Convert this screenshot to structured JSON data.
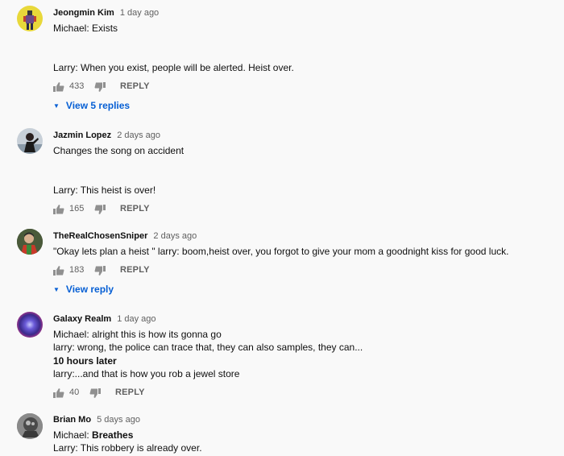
{
  "comments": [
    {
      "author": "Jeongmin Kim",
      "time": "1 day ago",
      "lines": [
        "Michael: Exists",
        "",
        "",
        "Larry: When you exist, people will be alerted. Heist over."
      ],
      "likes": "433",
      "reply_label": "REPLY",
      "view_replies": "View 5 replies"
    },
    {
      "author": "Jazmin Lopez",
      "time": "2 days ago",
      "lines": [
        "Changes the song on accident",
        "",
        "",
        "Larry: This heist is over!"
      ],
      "likes": "165",
      "reply_label": "REPLY"
    },
    {
      "author": "TheRealChosenSniper",
      "time": "2 days ago",
      "lines": [
        "\"Okay lets plan a heist \" larry: boom,heist over, you forgot to give your mom a goodnight kiss for good luck."
      ],
      "likes": "183",
      "reply_label": "REPLY",
      "view_replies": "View reply"
    },
    {
      "author": "Galaxy Realm",
      "time": "1 day ago",
      "lines": [
        "Michael: alright this is how its gonna go",
        "larry: wrong, the police can trace that, they can also samples, they can...",
        "10 hours later",
        "larry:...and that is how you rob a jewel store"
      ],
      "likes": "40",
      "reply_label": "REPLY"
    },
    {
      "author": "Brian Mo",
      "time": "5 days ago",
      "lines": [
        "Michael: ",
        "Breathes",
        "Larry: This robbery is already over."
      ]
    }
  ],
  "colors": {
    "link": "#065fd4",
    "meta": "#606060",
    "text": "#0f0f0f",
    "background": "#f9f9f9"
  }
}
